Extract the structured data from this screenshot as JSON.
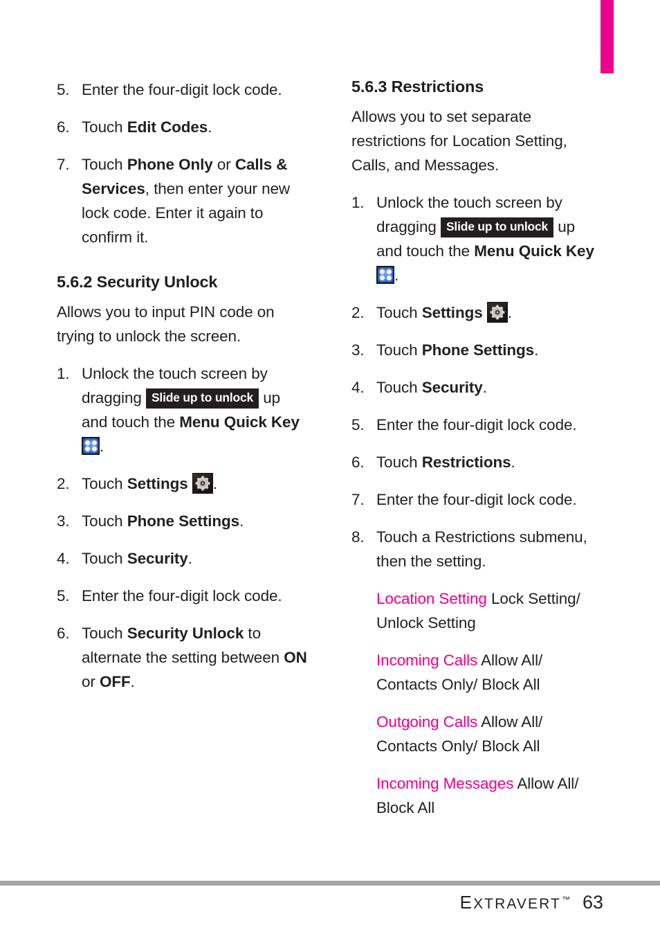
{
  "page": {
    "number": "63",
    "brand": "Extravert",
    "brand_first_letter": "E",
    "brand_rest": "XTRAVERT",
    "trademark": "™",
    "accent_color": "#ec008c",
    "tab_marker_color": "#ec008c",
    "rule_color": "#a7a4a5"
  },
  "left_column": {
    "continued_steps": [
      {
        "num": "5.",
        "parts": [
          {
            "text": "Enter the four-digit lock code.",
            "bold": false
          }
        ]
      },
      {
        "num": "6.",
        "parts": [
          {
            "text": "Touch ",
            "bold": false
          },
          {
            "text": "Edit Codes",
            "bold": true
          },
          {
            "text": ".",
            "bold": false
          }
        ]
      },
      {
        "num": "7.",
        "parts": [
          {
            "text": "Touch ",
            "bold": false
          },
          {
            "text": "Phone Only",
            "bold": true
          },
          {
            "text": " or ",
            "bold": false
          },
          {
            "text": "Calls & Services",
            "bold": true
          },
          {
            "text": ", then enter your new lock code. Enter it again to confirm it.",
            "bold": false
          }
        ]
      }
    ],
    "section": {
      "heading": "5.6.2 Security Unlock",
      "intro": "Allows you to input PIN code on trying to unlock the screen.",
      "steps": [
        {
          "num": "1.",
          "pre": "Unlock the touch screen by dragging",
          "badge": "Slide up to unlock",
          "mid": "up and touch the",
          "bold_term": "Menu Quick Key",
          "icon": "menu-quick-key-icon",
          "post": "."
        },
        {
          "num": "2.",
          "pre": "Touch",
          "bold_term": "Settings",
          "icon": "settings-gear-icon",
          "post": "."
        },
        {
          "num": "3.",
          "parts": [
            {
              "text": "Touch ",
              "bold": false
            },
            {
              "text": "Phone Settings",
              "bold": true
            },
            {
              "text": ".",
              "bold": false
            }
          ]
        },
        {
          "num": "4.",
          "parts": [
            {
              "text": "Touch ",
              "bold": false
            },
            {
              "text": "Security",
              "bold": true
            },
            {
              "text": ".",
              "bold": false
            }
          ]
        },
        {
          "num": "5.",
          "parts": [
            {
              "text": "Enter the four-digit lock code.",
              "bold": false
            }
          ]
        },
        {
          "num": "6.",
          "parts": [
            {
              "text": "Touch ",
              "bold": false
            },
            {
              "text": "Security Unlock",
              "bold": true
            },
            {
              "text": " to alternate the setting between ",
              "bold": false
            },
            {
              "text": "ON",
              "bold": true
            },
            {
              "text": " or ",
              "bold": false
            },
            {
              "text": "OFF",
              "bold": true
            },
            {
              "text": ".",
              "bold": false
            }
          ]
        }
      ]
    }
  },
  "right_column": {
    "section": {
      "heading": "5.6.3 Restrictions",
      "intro": "Allows you to set separate restrictions for Location Setting, Calls, and Messages.",
      "steps": [
        {
          "num": "1.",
          "pre": "Unlock the touch screen by dragging",
          "badge": "Slide up to unlock",
          "mid": "up and touch the",
          "bold_term": "Menu Quick Key",
          "icon": "menu-quick-key-icon",
          "post": "."
        },
        {
          "num": "2.",
          "pre": "Touch",
          "bold_term": "Settings",
          "icon": "settings-gear-icon",
          "post": "."
        },
        {
          "num": "3.",
          "parts": [
            {
              "text": "Touch ",
              "bold": false
            },
            {
              "text": "Phone Settings",
              "bold": true
            },
            {
              "text": ".",
              "bold": false
            }
          ]
        },
        {
          "num": "4.",
          "parts": [
            {
              "text": "Touch ",
              "bold": false
            },
            {
              "text": "Security",
              "bold": true
            },
            {
              "text": ".",
              "bold": false
            }
          ]
        },
        {
          "num": "5.",
          "parts": [
            {
              "text": "Enter the four-digit lock code.",
              "bold": false
            }
          ]
        },
        {
          "num": "6.",
          "parts": [
            {
              "text": "Touch ",
              "bold": false
            },
            {
              "text": "Restrictions",
              "bold": true
            },
            {
              "text": ".",
              "bold": false
            }
          ]
        },
        {
          "num": "7.",
          "parts": [
            {
              "text": "Enter the four-digit lock code.",
              "bold": false
            }
          ]
        },
        {
          "num": "8.",
          "parts": [
            {
              "text": "Touch a Restrictions submenu, then the setting.",
              "bold": false
            }
          ]
        }
      ],
      "submenu_entries": [
        {
          "label": "Location Setting",
          "options": "Lock Setting/ Unlock Setting"
        },
        {
          "label": "Incoming Calls",
          "options": "Allow All/ Contacts Only/ Block All"
        },
        {
          "label": "Outgoing Calls",
          "options": "Allow All/ Contacts Only/ Block All"
        },
        {
          "label": "Incoming Messages",
          "options": "Allow All/ Block All"
        }
      ]
    }
  }
}
